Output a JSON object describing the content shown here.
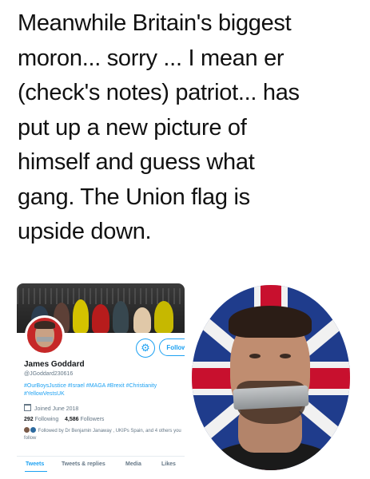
{
  "tweet": {
    "lines": [
      "Meanwhile Britain's biggest",
      "moron... sorry ... I mean er",
      "(check's notes) patriot... has",
      "put up a new picture of",
      "himself and guess what",
      "gang. The Union flag is",
      "upside down."
    ]
  },
  "profile": {
    "follow_label": "Follow",
    "settings_icon": "gear-icon",
    "name": "James Goddard",
    "handle": "@JGoddard230616",
    "hashtags": "#OurBoysJustice #Israel #MAGA #Brexit #Christianity #YellowVestsUK",
    "joined": "Joined June 2018",
    "following_count": "292",
    "following_label": "Following",
    "followers_count": "4,586",
    "followers_label": "Followers",
    "followed_by": "Followed by Dr Benjamin Janaway , UKIPs Spain, and 4 others you follow",
    "tabs": [
      "Tweets",
      "Tweets & replies",
      "Media",
      "Likes"
    ],
    "accent_color": "#1da1f2"
  }
}
